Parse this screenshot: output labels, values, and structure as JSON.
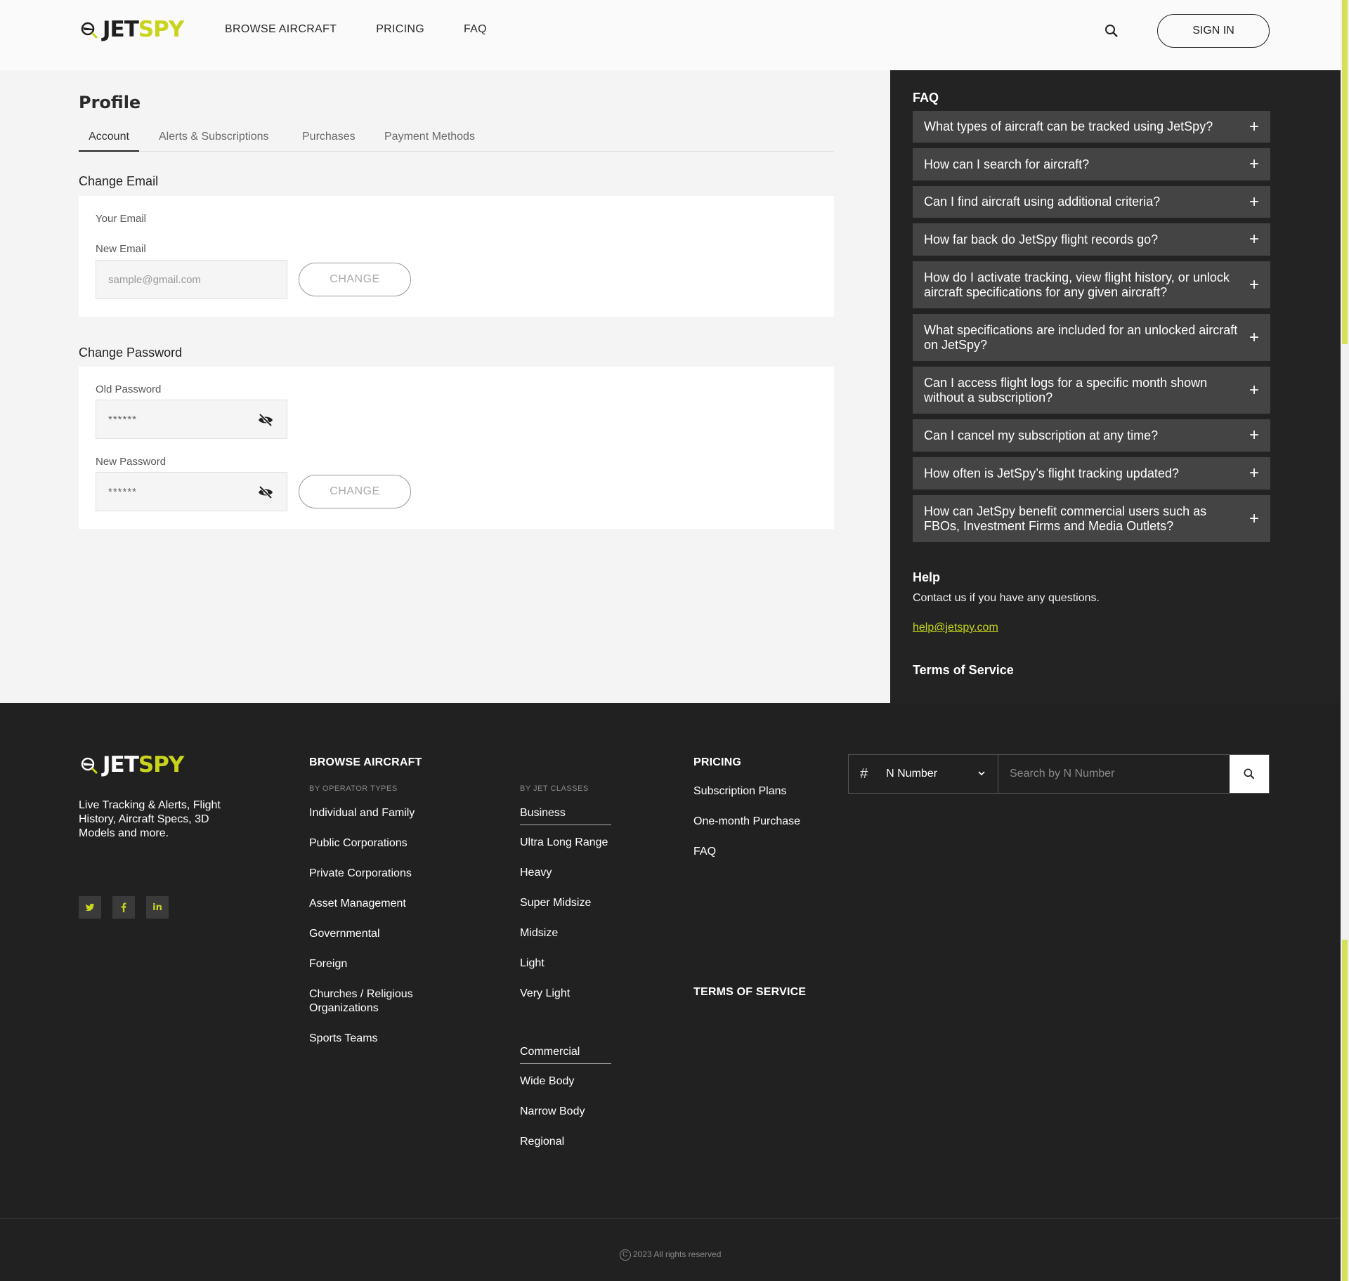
{
  "brand": {
    "logo_a": "JET",
    "logo_b": "SPY",
    "accent": "#c8d41c"
  },
  "header": {
    "nav": [
      "BROWSE AIRCRAFT",
      "PRICING",
      "FAQ"
    ],
    "signin": "SIGN IN"
  },
  "profile": {
    "title": "Profile",
    "tabs": [
      "Account",
      "Alerts & Subscriptions",
      "Purchases",
      "Payment Methods"
    ],
    "email_section": {
      "title": "Change Email",
      "your_email_label": "Your Email",
      "new_email_label": "New Email",
      "new_email_placeholder": "sample@gmail.com",
      "button": "CHANGE"
    },
    "password_section": {
      "title": "Change Password",
      "old_label": "Old Password",
      "old_value": "******",
      "new_label": "New Password",
      "new_value": "******",
      "button": "CHANGE"
    }
  },
  "side": {
    "faq_title": "FAQ",
    "faq": [
      "What types of aircraft can be tracked using JetSpy?",
      "How can I search for aircraft?",
      "Can I find aircraft using additional criteria?",
      "How far back do JetSpy flight records go?",
      "How do I activate tracking, view flight history, or unlock aircraft specifications for any given aircraft?",
      "What specifications are included for an unlocked aircraft on JetSpy?",
      "Can I access flight logs for a specific month shown without a subscription?",
      "Can I cancel my subscription at any time?",
      "How often is JetSpy’s flight tracking updated?",
      "How can JetSpy benefit commercial users such as FBOs, Investment Firms and Media Outlets?"
    ],
    "help_title": "Help",
    "help_text": "Contact us if you have any questions.",
    "help_email": "help@jetspy.com",
    "tos": "Terms of Service"
  },
  "footer": {
    "tagline": "Live Tracking & Alerts, Flight History, Aircraft Specs, 3D Models and more.",
    "social": [
      "twitter-icon",
      "facebook-icon",
      "linkedin-icon"
    ],
    "browse_head": "BROWSE AIRCRAFT",
    "operator_sub": "BY OPERATOR TYPES",
    "operator_types": [
      "Individual and Family",
      "Public Corporations",
      "Private Corporations",
      "Asset Management",
      "Governmental",
      "Foreign",
      "Churches / Religious Organizations",
      "Sports Teams"
    ],
    "jet_sub": "BY JET CLASSES",
    "business": "Business",
    "business_classes": [
      "Ultra Long Range",
      "Heavy",
      "Super Midsize",
      "Midsize",
      "Light",
      "Very Light"
    ],
    "commercial": "Commercial",
    "commercial_classes": [
      "Wide Body",
      "Narrow Body",
      "Regional"
    ],
    "pricing_head": "PRICING",
    "pricing_links": [
      "Subscription Plans",
      "One-month Purchase",
      "FAQ"
    ],
    "tos_head": "TERMS OF SERVICE",
    "search": {
      "select": "N Number",
      "placeholder": "Search by N Number"
    },
    "copyright": "2023 All rights reserved"
  }
}
